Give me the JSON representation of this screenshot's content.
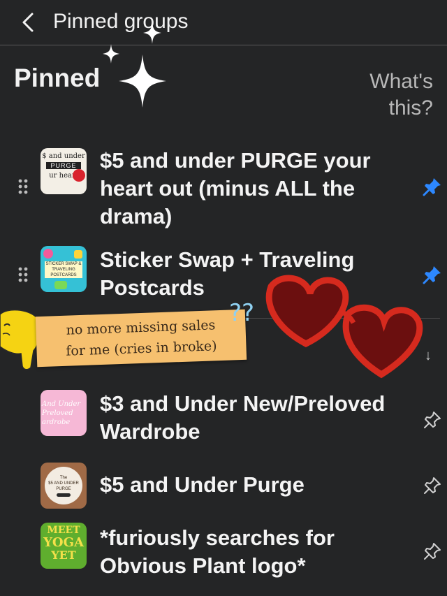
{
  "header": {
    "title": "Pinned groups"
  },
  "section": {
    "title": "Pinned",
    "whats_this": "What's this?"
  },
  "pinned_groups": [
    {
      "name": "$5 and under PURGE your heart out (minus ALL the drama)",
      "thumb_lines": [
        "$ and under",
        "PURGE",
        "ur heart"
      ],
      "pinned": true
    },
    {
      "name": "Sticker Swap + Traveling Postcards",
      "thumb_lines": [
        "STICKER SWAP &",
        "TRAVELING POSTCARDS"
      ],
      "pinned": true
    }
  ],
  "other_groups": [
    {
      "name": "$3 and Under New/Preloved Wardrobe",
      "thumb_lines": [
        "And Under",
        "Preloved",
        "ardrobe"
      ],
      "pinned": false
    },
    {
      "name": "$5 and Under Purge",
      "thumb_lines": [
        "The",
        "$5 AND UNDER",
        "PURGE"
      ],
      "pinned": false
    },
    {
      "name": "*furiously searches for Obvious Plant logo*",
      "thumb_lines": [
        "MEET",
        "YOGA",
        "YET"
      ],
      "pinned": false
    }
  ],
  "sticker_note": {
    "line1": "no more missing sales",
    "line2": "for me (cries in broke)",
    "qmarks": "??"
  },
  "colors": {
    "background": "#242526",
    "pin_active": "#2d88ff",
    "pin_inactive": "#d0d0d0",
    "sticky": "#f6c06f"
  }
}
